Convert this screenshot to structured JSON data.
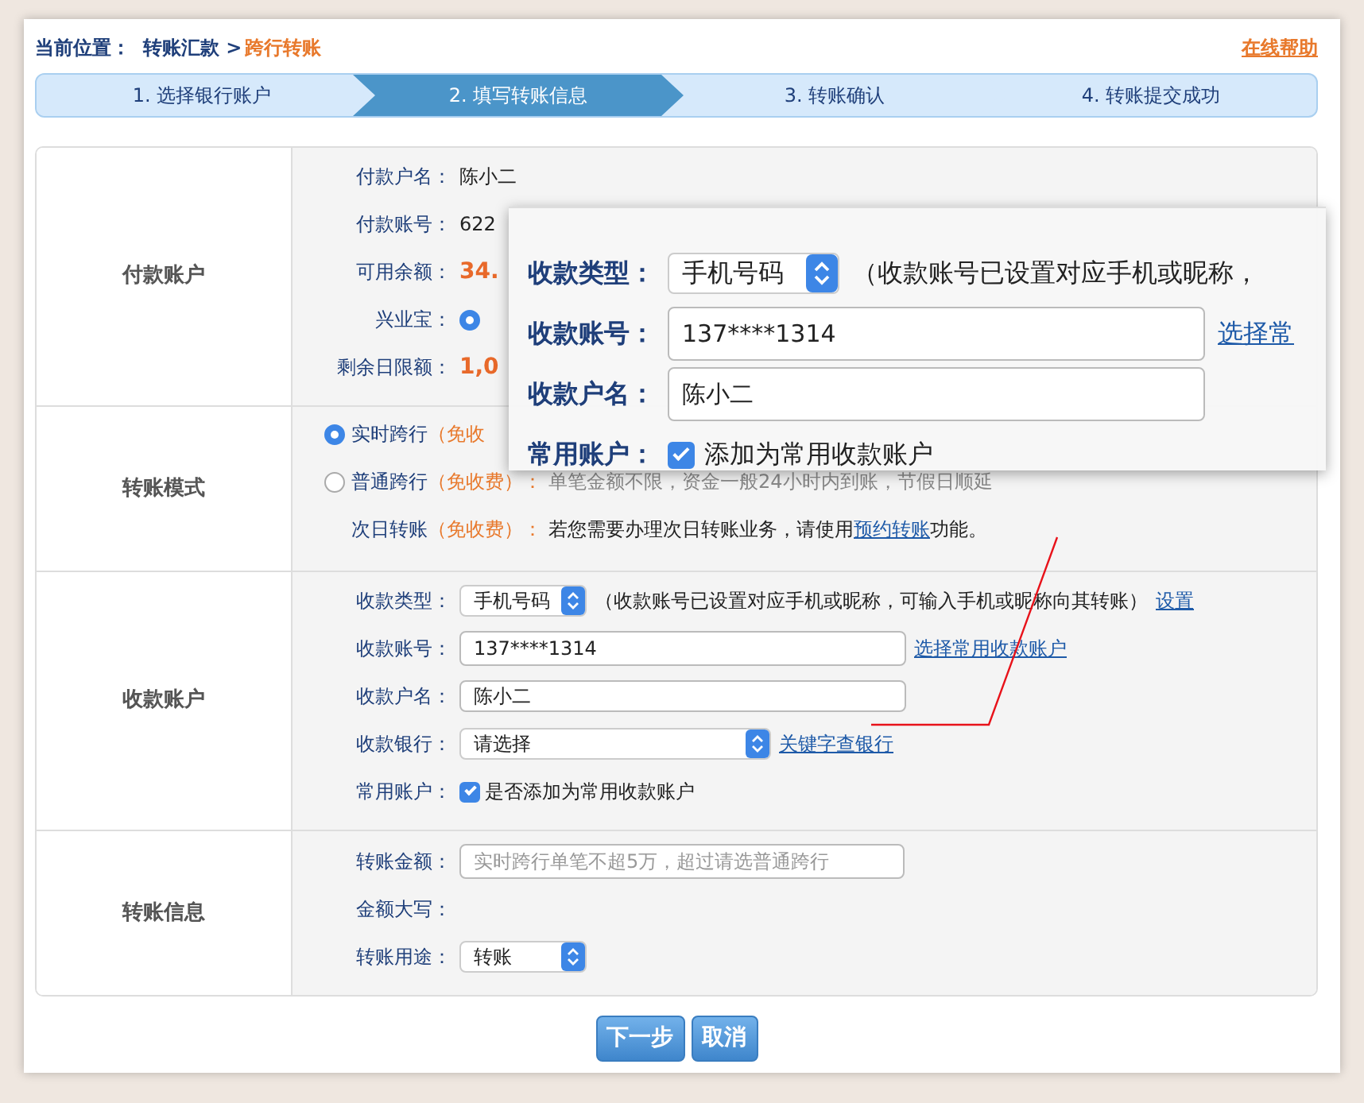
{
  "breadcrumb": {
    "label": "当前位置：",
    "path": "转账汇款 >",
    "current": "跨行转账"
  },
  "help_link": "在线帮助",
  "steps": [
    {
      "label": "1. 选择银行账户",
      "selected": false
    },
    {
      "label": "2. 填写转账信息",
      "selected": true
    },
    {
      "label": "3. 转账确认",
      "selected": false
    },
    {
      "label": "4. 转账提交成功",
      "selected": false
    }
  ],
  "payer": {
    "title": "付款账户",
    "rows": [
      {
        "kind": "text",
        "label": "付款户名：",
        "value": "陈小二"
      },
      {
        "kind": "text",
        "label": "付款账号：",
        "value": "622"
      },
      {
        "kind": "amount",
        "label": "可用余额：",
        "value": "34."
      },
      {
        "kind": "radio",
        "label": "兴业宝：",
        "selected": true
      },
      {
        "kind": "amount",
        "label": "剩余日限额：",
        "value": "1,0"
      }
    ]
  },
  "mode": {
    "title": "转账模式",
    "options": [
      {
        "kind": "radio",
        "selected": true,
        "label": "实时跨行",
        "fee": "（免收"
      },
      {
        "kind": "radio",
        "selected": false,
        "label": "普通跨行",
        "fee": "（免收费）：",
        "note": "单笔金额不限，资金一般24小时内到账，节假日顺延"
      },
      {
        "kind": "text",
        "label": "次日转账",
        "fee": "（免收费）：",
        "note": "若您需要办理次日转账业务，请使用",
        "link": "预约转账",
        "note_after": "功能。"
      }
    ]
  },
  "payee": {
    "title": "收款账户",
    "rows": [
      {
        "kind": "select",
        "label": "收款类型：",
        "value": "手机号码",
        "note": "（收款账号已设置对应手机或昵称，可输入手机或昵称向其转账）",
        "link": "设置"
      },
      {
        "kind": "input",
        "label": "收款账号：",
        "value": "137****1314",
        "link": "选择常用收款账户"
      },
      {
        "kind": "input",
        "label": "收款户名：",
        "value": "陈小二"
      },
      {
        "kind": "select",
        "label": "收款银行：",
        "value": "请选择",
        "link": "关键字查银行"
      },
      {
        "kind": "checkbox",
        "label": "常用账户：",
        "text": "是否添加为常用收款账户",
        "checked": true
      }
    ]
  },
  "transfer": {
    "title": "转账信息",
    "rows": [
      {
        "kind": "input",
        "label": "转账金额：",
        "placeholder": "实时跨行单笔不超5万，超过请选普通跨行"
      },
      {
        "kind": "text",
        "label": "金额大写："
      },
      {
        "kind": "select",
        "label": "转账用途：",
        "value": "转账"
      }
    ]
  },
  "buttons": [
    "下一步",
    "取消"
  ],
  "callout": {
    "rows": [
      {
        "kind": "select",
        "label": "收款类型：",
        "value": "手机号码",
        "note": "（收款账号已设置对应手机或昵称，"
      },
      {
        "kind": "input",
        "label": "收款账号：",
        "value": "137****1314",
        "link": "选择常"
      },
      {
        "kind": "input",
        "label": "收款户名：",
        "value": "陈小二"
      },
      {
        "kind": "checkbox",
        "label": "常用账户：",
        "text": "添加为常用收款账户",
        "checked": true
      }
    ]
  }
}
